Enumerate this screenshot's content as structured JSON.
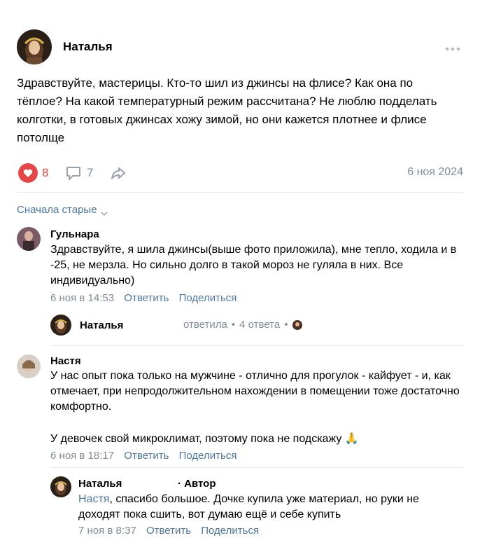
{
  "post": {
    "author": "Наталья",
    "text": "Здравствуйте, мастерицы. Кто-то шил из джинсы на флисе? Как она по тёплое? На какой температурный режим рассчитана? Не люблю подделать колготки, в готовых джинсах хожу зимой, но они кажется плотнее и флисе потолще",
    "likes": "8",
    "comments": "7",
    "date": "6 ноя 2024"
  },
  "sort_label": "Сначала старые",
  "actions": {
    "reply": "Ответить",
    "share": "Поделиться"
  },
  "comments": [
    {
      "author": "Гульнара",
      "text": "Здравствуйте, я шила джинсы(выше фото приложила), мне тепло, ходила и в -25, не мерзла. Но сильно долго в такой мороз не гуляла в них. Все индивидуально)",
      "date": "6 ноя в 14:53",
      "thread": {
        "author": "Наталья",
        "replied": "ответила",
        "answers": "4 ответа"
      }
    },
    {
      "author": "Настя",
      "text1": "У нас опыт пока только на мужчине - отлично для прогулок - кайфует - и, как отмечает, при непродолжительном нахождении в помещении тоже достаточно комфортно.",
      "text2": "У девочек свой микроклимат, поэтому пока не подскажу 🙏",
      "date": "6 ноя в 18:17",
      "reply": {
        "author": "Наталья",
        "badge": "· Автор",
        "mention": "Настя",
        "text": ", спасибо большое. Дочке купила уже материал, но руки не доходят пока сшить, вот думаю ещё и себе купить",
        "date": "7 ноя в 8:37"
      }
    }
  ],
  "colors": {
    "accent": "#4c77a2",
    "like": "#e64646",
    "muted": "#818c99",
    "divider": "#e7e8ec"
  },
  "icons": [
    "more-icon",
    "heart-icon",
    "comment-icon",
    "share-icon",
    "chevron-down-icon"
  ]
}
